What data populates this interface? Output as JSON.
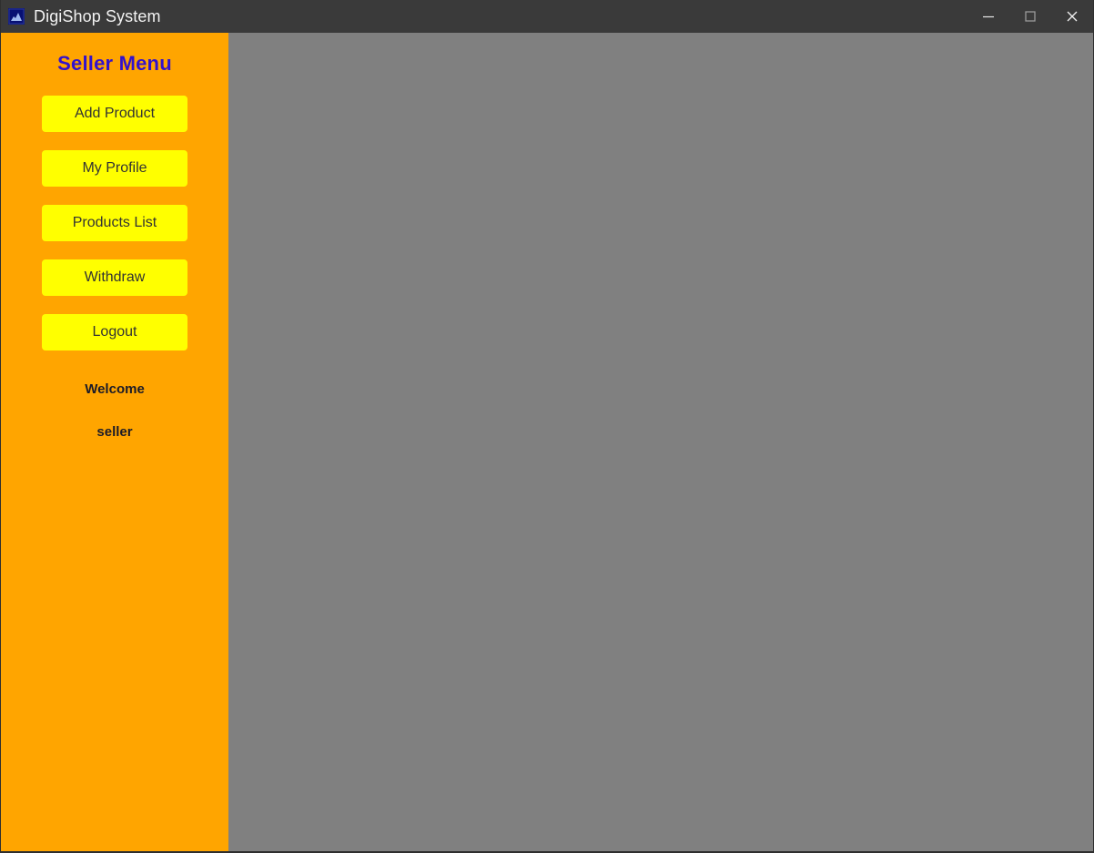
{
  "window": {
    "title": "DigiShop System",
    "icon": "app-mountain-icon",
    "controls": {
      "minimize": "minimize-icon",
      "maximize": "maximize-icon",
      "close": "close-icon"
    }
  },
  "colors": {
    "titlebar_bg": "#3a3a3a",
    "titlebar_text": "#f2f2f2",
    "sidebar_bg": "#FFA500",
    "sidebar_title": "#3311CC",
    "button_bg": "#FFFF00",
    "button_text": "#333333",
    "content_bg": "#808080",
    "welcome_text": "#1b1b28",
    "icon_bg": "#081073",
    "icon_shape": "#9fb8ef"
  },
  "sidebar": {
    "title": "Seller Menu",
    "buttons": [
      {
        "label": "Add Product"
      },
      {
        "label": "My Profile"
      },
      {
        "label": "Products List"
      },
      {
        "label": "Withdraw"
      },
      {
        "label": "Logout"
      }
    ],
    "welcome_label": "Welcome",
    "username": "seller"
  },
  "main": {
    "content": ""
  }
}
